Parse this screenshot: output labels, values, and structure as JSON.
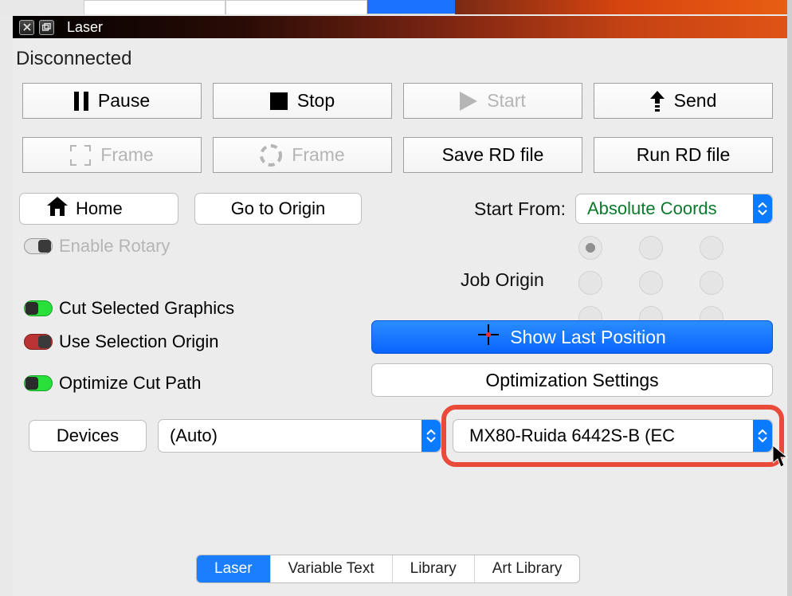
{
  "title": "Laser",
  "status": "Disconnected",
  "buttons": {
    "pause": "Pause",
    "stop": "Stop",
    "start": "Start",
    "send": "Send",
    "frame_rect": "Frame",
    "frame_circle": "Frame",
    "save_rd": "Save RD file",
    "run_rd": "Run RD file",
    "home": "Home",
    "go_origin": "Go to Origin",
    "show_last_position": "Show Last Position",
    "optimization_settings": "Optimization Settings",
    "devices": "Devices"
  },
  "labels": {
    "start_from": "Start From:",
    "job_origin": "Job Origin"
  },
  "toggles": {
    "enable_rotary": "Enable Rotary",
    "cut_selected": "Cut Selected Graphics",
    "use_selection_origin": "Use Selection Origin",
    "optimize_cut_path": "Optimize Cut Path"
  },
  "selects": {
    "start_from_value": "Absolute Coords",
    "auto": "(Auto)",
    "device": "MX80-Ruida 6442S-B (EC"
  },
  "bottom_tabs": [
    "Laser",
    "Variable Text",
    "Library",
    "Art Library"
  ],
  "bottom_tab_active_index": 0
}
